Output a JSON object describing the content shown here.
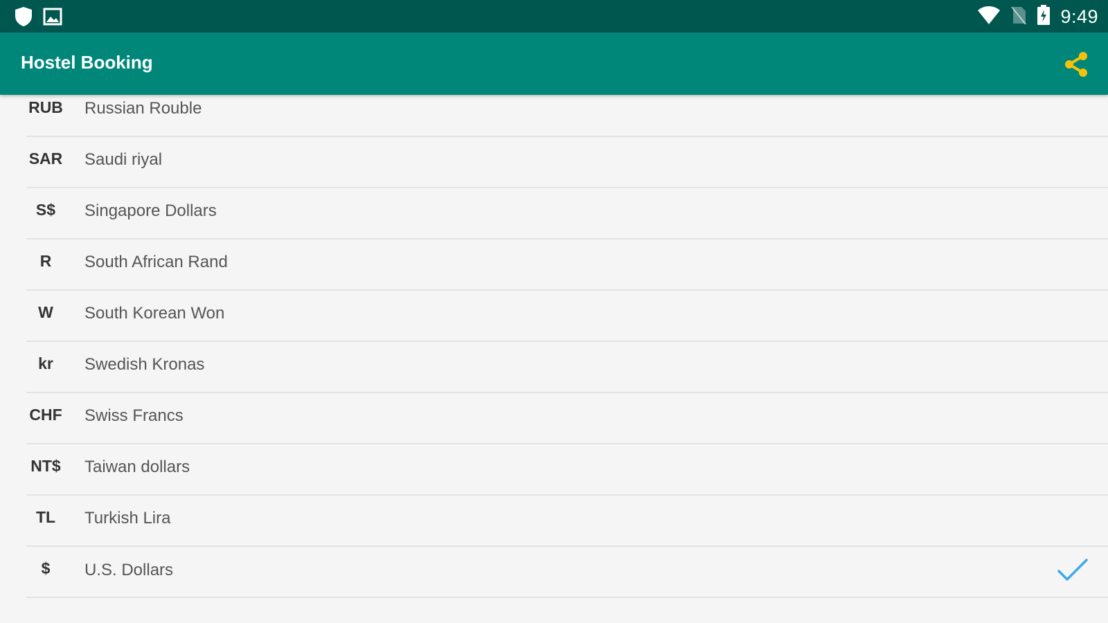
{
  "status_bar": {
    "time": "9:49",
    "left_icons": [
      "shield-icon",
      "image-icon"
    ],
    "right_icons": [
      "wifi-icon",
      "no-sim-icon",
      "battery-charging-icon"
    ]
  },
  "app_bar": {
    "title": "Hostel Booking",
    "share_icon": "share-icon",
    "share_color": "#f4c20d"
  },
  "colors": {
    "status_bar": "#00574f",
    "app_bar": "#00877a",
    "check": "#3da9e8"
  },
  "currencies": [
    {
      "symbol": "RUB",
      "name": "Russian Rouble",
      "selected": false
    },
    {
      "symbol": "SAR",
      "name": "Saudi riyal",
      "selected": false
    },
    {
      "symbol": "S$",
      "name": "Singapore Dollars",
      "selected": false
    },
    {
      "symbol": "R",
      "name": "South African Rand",
      "selected": false
    },
    {
      "symbol": "W",
      "name": "South Korean Won",
      "selected": false
    },
    {
      "symbol": "kr",
      "name": "Swedish Kronas",
      "selected": false
    },
    {
      "symbol": "CHF",
      "name": "Swiss Francs",
      "selected": false
    },
    {
      "symbol": "NT$",
      "name": "Taiwan dollars",
      "selected": false
    },
    {
      "symbol": "TL",
      "name": "Turkish Lira",
      "selected": false
    },
    {
      "symbol": "$",
      "name": "U.S. Dollars",
      "selected": true
    }
  ]
}
